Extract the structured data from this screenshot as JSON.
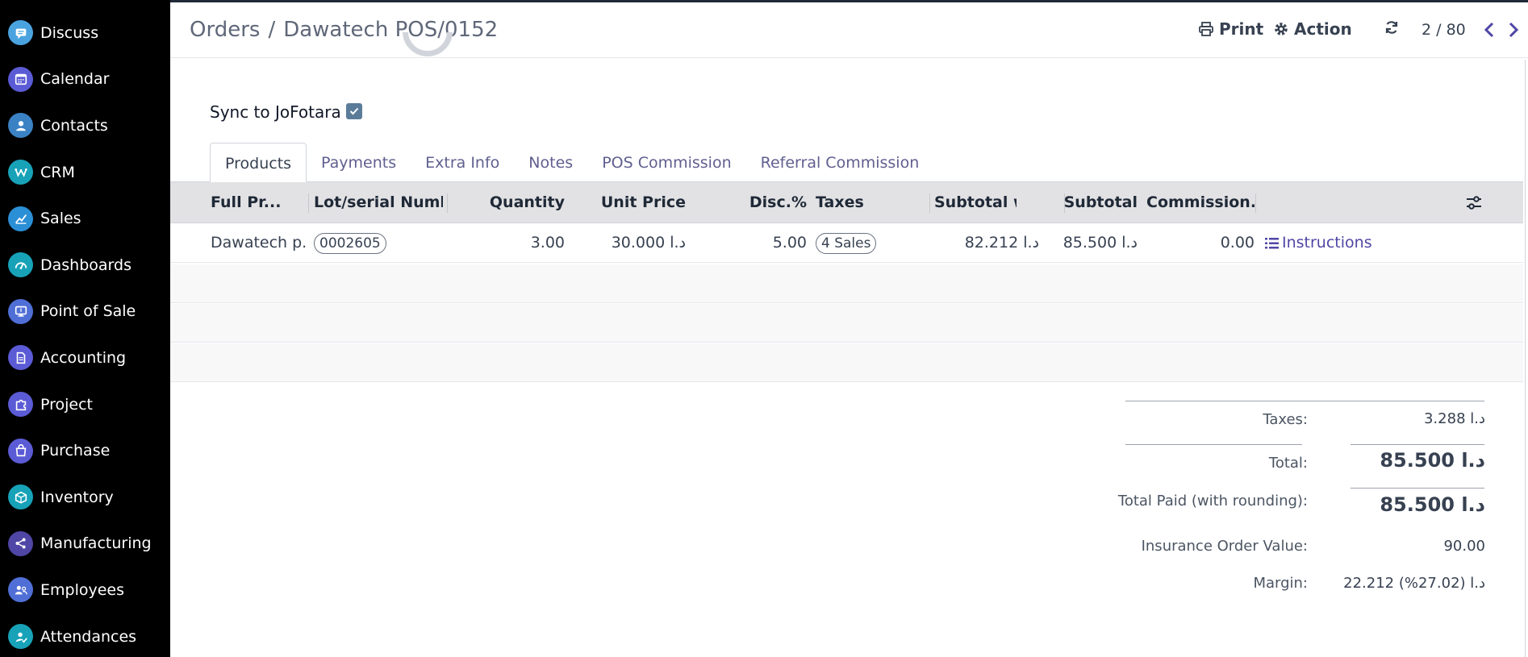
{
  "sidebar": {
    "items": [
      {
        "label": "Discuss",
        "icon": "chat-icon",
        "color": "#4aa3df"
      },
      {
        "label": "Calendar",
        "icon": "calendar-icon",
        "color": "#5b5bd6"
      },
      {
        "label": "Contacts",
        "icon": "person-icon",
        "color": "#3b82c4"
      },
      {
        "label": "CRM",
        "icon": "crm-icon",
        "color": "#17a2b8"
      },
      {
        "label": "Sales",
        "icon": "sales-chart-icon",
        "color": "#2b8fd6"
      },
      {
        "label": "Dashboards",
        "icon": "dashboard-icon",
        "color": "#17a2b8"
      },
      {
        "label": "Point of Sale",
        "icon": "monitor-icon",
        "color": "#4f6fd6"
      },
      {
        "label": "Accounting",
        "icon": "document-icon",
        "color": "#5b5bd6"
      },
      {
        "label": "Project",
        "icon": "puzzle-icon",
        "color": "#5b5bd6"
      },
      {
        "label": "Purchase",
        "icon": "shopping-bag-icon",
        "color": "#5b5bd6"
      },
      {
        "label": "Inventory",
        "icon": "box-icon",
        "color": "#17a2b8"
      },
      {
        "label": "Manufacturing",
        "icon": "nodes-icon",
        "color": "#4f46a5"
      },
      {
        "label": "Employees",
        "icon": "users-icon",
        "color": "#4f6fd6"
      },
      {
        "label": "Attendances",
        "icon": "user-check-icon",
        "color": "#17a2b8"
      }
    ]
  },
  "header": {
    "breadcrumb_parent": "Orders",
    "breadcrumb_separator": "/",
    "breadcrumb_current": "Dawatech POS/0152",
    "print_label": "Print",
    "action_label": "Action",
    "pager": "2 / 80"
  },
  "form": {
    "sync_label": "Sync to JoFotara",
    "sync_checked": true
  },
  "tabs": [
    "Products",
    "Payments",
    "Extra Info",
    "Notes",
    "POS Commission",
    "Referral Commission"
  ],
  "table": {
    "columns": [
      "Full Pr...",
      "Lot/serial Numb...",
      "Quantity",
      "Unit Price",
      "Disc.%",
      "Taxes",
      "Subtotal w/...",
      "Subtotal",
      "Commission..."
    ],
    "rows": [
      {
        "product": "Dawatech p...",
        "lot": "0002605",
        "quantity": "3.00",
        "unit_price": "30.000 د.ا",
        "discount": "5.00",
        "taxes": "4 Sales",
        "subtotal_wo": "82.212 د.ا",
        "subtotal": "85.500 د.ا",
        "commission": "0.00",
        "action": "Instructions"
      }
    ]
  },
  "totals": {
    "taxes_label": "Taxes:",
    "taxes_value": "3.288 د.ا",
    "total_label": "Total:",
    "total_value": "85.500 د.ا",
    "paid_label": "Total Paid (with rounding):",
    "paid_value": "85.500 د.ا",
    "insurance_label": "Insurance Order Value:",
    "insurance_value": "90.00",
    "margin_label": "Margin:",
    "margin_value": "22.212 د.ا (27.02%)"
  }
}
